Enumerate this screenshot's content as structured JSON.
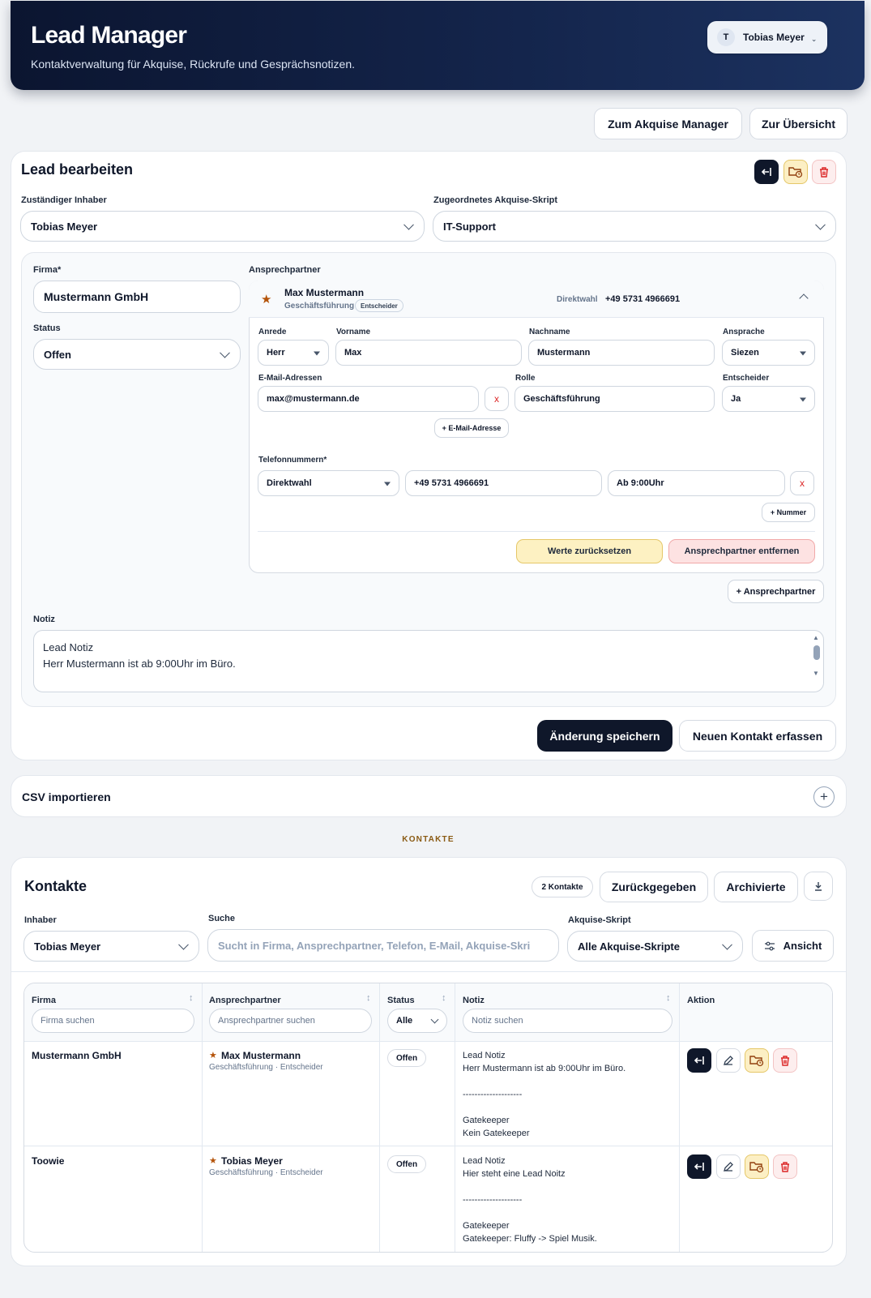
{
  "header": {
    "title": "Lead Manager",
    "subtitle": "Kontaktverwaltung für Akquise, Rückrufe und Gesprächsnotizen.",
    "user_initial": "T",
    "user_name": "Tobias Meyer"
  },
  "nav": {
    "akquise": "Zum Akquise Manager",
    "overview": "Zur Übersicht"
  },
  "edit": {
    "title": "Lead bearbeiten",
    "owner_label": "Zuständiger Inhaber",
    "owner_value": "Tobias Meyer",
    "script_label": "Zugeordnetes Akquise-Skript",
    "script_value": "IT-Support",
    "company_label": "Firma*",
    "company_value": "Mustermann GmbH",
    "status_label": "Status",
    "status_value": "Offen",
    "contacts_label": "Ansprechpartner",
    "contact": {
      "name": "Max Mustermann",
      "role": "Geschäftsführung",
      "badge": "Entscheider",
      "phone_label": "Direktwahl",
      "phone_value": "+49 5731 4966691",
      "anrede_label": "Anrede",
      "anrede_value": "Herr",
      "vorname_label": "Vorname",
      "vorname_value": "Max",
      "nachname_label": "Nachname",
      "nachname_value": "Mustermann",
      "ansprache_label": "Ansprache",
      "ansprache_value": "Siezen",
      "email_label": "E-Mail-Adressen",
      "email_value": "max@mustermann.de",
      "rolle_label": "Rolle",
      "rolle_value": "Geschäftsführung",
      "entscheider_label": "Entscheider",
      "entscheider_value": "Ja",
      "add_email": "+ E-Mail-Adresse",
      "phones_label": "Telefonnummern*",
      "phone_type": "Direktwahl",
      "phone_number": "+49 5731 4966691",
      "phone_note": "Ab 9:00Uhr",
      "add_number": "+ Nummer",
      "reset": "Werte zurücksetzen",
      "remove": "Ansprechpartner entfernen",
      "remove_x": "x"
    },
    "add_contact": "+ Ansprechpartner",
    "note_label": "Notiz",
    "note_line1": "Lead Notiz",
    "note_line2": "Herr Mustermann ist ab 9:00Uhr im Büro.",
    "save": "Änderung speichern",
    "new_contact": "Neuen Kontakt erfassen"
  },
  "csv": {
    "title": "CSV importieren"
  },
  "section_label": "KONTAKTE",
  "contacts": {
    "title": "Kontakte",
    "count": "2 Kontakte",
    "returned": "Zurückgegeben",
    "archived": "Archivierte",
    "owner_label": "Inhaber",
    "owner_value": "Tobias Meyer",
    "search_label": "Suche",
    "search_placeholder": "Sucht in Firma, Ansprechpartner, Telefon, E-Mail, Akquise-Skri",
    "script_label": "Akquise-Skript",
    "script_value": "Alle Akquise-Skripte",
    "view": "Ansicht",
    "columns": {
      "firma": "Firma",
      "ansprechpartner": "Ansprechpartner",
      "status": "Status",
      "notiz": "Notiz",
      "aktion": "Aktion"
    },
    "filters": {
      "firma": "Firma suchen",
      "ansprechpartner": "Ansprechpartner suchen",
      "status": "Alle",
      "notiz": "Notiz suchen"
    },
    "rows": [
      {
        "firma": "Mustermann GmbH",
        "contact": "Max Mustermann",
        "contact_sub": "Geschäftsführung · Entscheider",
        "status": "Offen",
        "note": "Lead Notiz\nHerr Mustermann ist ab 9:00Uhr im Büro.\n\n--------------------\n\nGatekeeper\nKein Gatekeeper"
      },
      {
        "firma": "Toowie",
        "contact": "Tobias Meyer",
        "contact_sub": "Geschäftsführung · Entscheider",
        "status": "Offen",
        "note": "Lead Notiz\nHier steht eine Lead Noitz\n\n--------------------\n\nGatekeeper\nGatekeeper: Fluffy -> Spiel Musik."
      }
    ]
  },
  "colors": {
    "dark": "#0f172a",
    "accent_yellow": "#fcefc4",
    "accent_red": "#fdeeee",
    "star": "#b45309"
  }
}
